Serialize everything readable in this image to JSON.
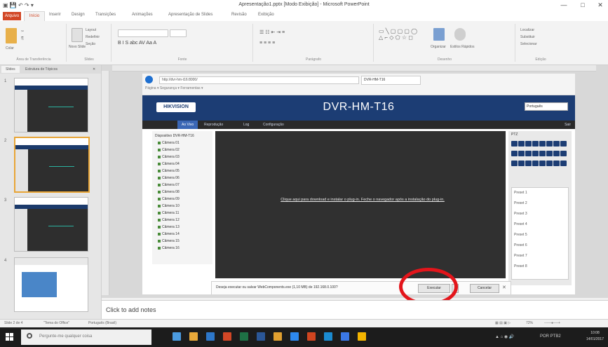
{
  "window": {
    "title": "Apresentação1.pptx [Modo Exibição] - Microsoft PowerPoint",
    "controls": [
      "—",
      "□",
      "✕"
    ]
  },
  "ribbon_tabs": [
    "Arquivo",
    "Início",
    "Inserir",
    "Design",
    "Transições",
    "Animações",
    "Apresentação de Slides",
    "Revisão",
    "Exibição"
  ],
  "ribbon_groups": [
    "Área de Transferência",
    "Slides",
    "Fonte",
    "Parágrafo",
    "Desenho",
    "Edição"
  ],
  "ribbon_buttons": {
    "paste": "Colar",
    "new_slide": "Novo Slide",
    "layout": "Layout",
    "reset": "Redefinir",
    "section": "Seção",
    "arrange": "Organizar",
    "quick_styles": "Estilos Rápidos",
    "find": "Localizar",
    "replace": "Substituir",
    "select": "Selecionar"
  },
  "slide_panel": {
    "tabs": [
      "Slides",
      "Estrutura de Tópicos"
    ],
    "numbers": [
      "1",
      "2",
      "3",
      "4"
    ]
  },
  "browser": {
    "address": "http://dvr-hm-t16:8000/",
    "tab_title": "DVR-HM-T16",
    "toolbar": "Página ▾  Segurança ▾  Ferramentas ▾"
  },
  "dvr": {
    "logo": "HIKVISION",
    "title": "DVR-HM-T16",
    "language": "Português",
    "nav": [
      "Ao Vivo",
      "Reprodução",
      "Log",
      "Configuração"
    ],
    "nav_right": "Sair",
    "device": "Dispositivo DVR-HM-T16",
    "cameras": [
      "Câmera 01",
      "Câmera 02",
      "Câmera 03",
      "Câmera 04",
      "Câmera 05",
      "Câmera 06",
      "Câmera 07",
      "Câmera 08",
      "Câmera 09",
      "Câmera 10",
      "Câmera 11",
      "Câmera 12",
      "Câmera 13",
      "Câmera 14",
      "Câmera 15",
      "Câmera 16"
    ],
    "plugin_message": "Clique aqui para download e instalar o plug-in. Feche o navegador após a instalação do plug-in.",
    "ptz_label": "PTZ",
    "presets": [
      "Preset 1",
      "Preset 2",
      "Preset 3",
      "Preset 4",
      "Preset 5",
      "Preset 6",
      "Preset 7",
      "Preset 8"
    ]
  },
  "download_bar": {
    "message": "Deseja executar ou salvar WebComponents.exe (1,10 MB) de 192.168.0.100?",
    "run": "Executar",
    "cancel": "Cancelar"
  },
  "notes": {
    "placeholder": "Click to add notes"
  },
  "status": {
    "slide": "Slide 2 de 4",
    "theme": "\"Tema do Office\"",
    "language": "Português (Brasil)",
    "zoom": "72%"
  },
  "taskbar": {
    "search": "Pergunte-me qualquer coisa",
    "time": "10:08",
    "date": "14/01/2017",
    "lang": "POR PTB2"
  },
  "colors": {
    "file_tab": "#d24726",
    "dvr_header": "#1c3d74",
    "highlight": "#e3151b"
  }
}
